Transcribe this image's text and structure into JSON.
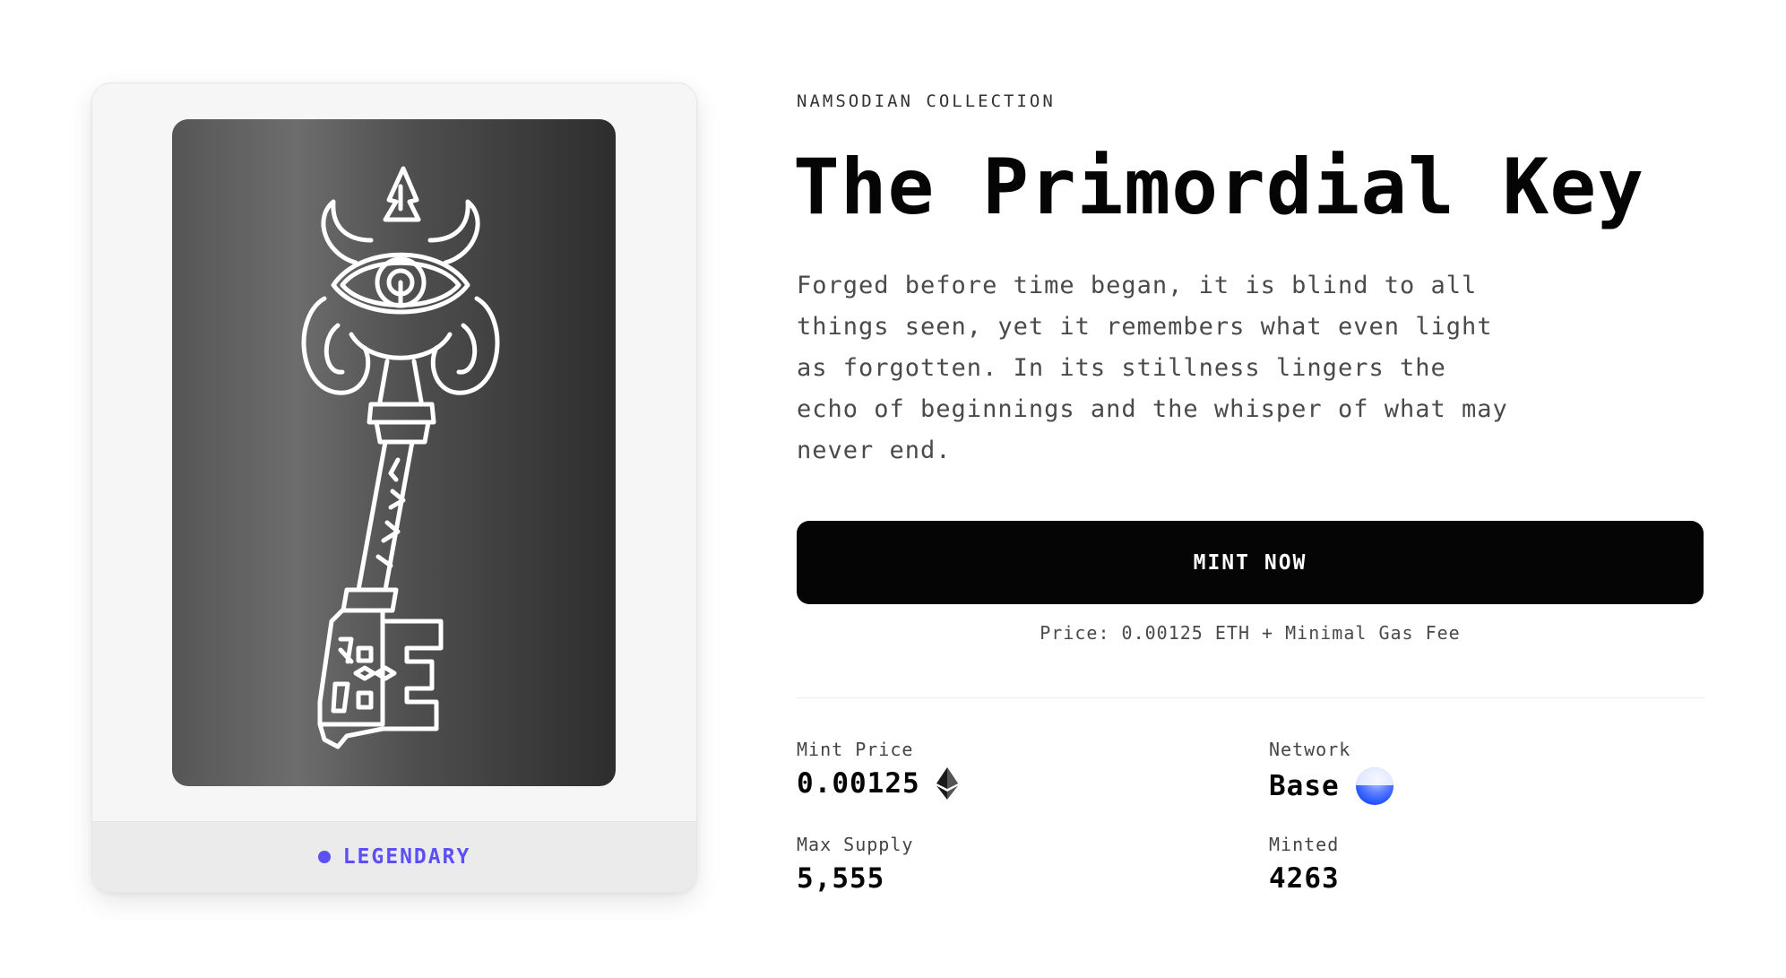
{
  "card": {
    "rarity": "LEGENDARY",
    "rarity_color": "#5b4ff5",
    "image_alt_icon": "primordial-key-artwork"
  },
  "collection": "NAMSODIAN COLLECTION",
  "title": "The Primordial Key",
  "description": "Forged before time began, it is blind to all things seen, yet it remembers what even light as forgotten. In its stillness lingers the echo of beginnings and the whisper of what may never end.",
  "mint_button": "MINT NOW",
  "price_note": "Price: 0.00125 ETH + Minimal Gas Fee",
  "stats": {
    "mint_price": {
      "label": "Mint Price",
      "value": "0.00125",
      "icon": "ethereum-icon"
    },
    "network": {
      "label": "Network",
      "value": "Base",
      "icon": "base-network-icon"
    },
    "max_supply": {
      "label": "Max Supply",
      "value": "5,555"
    },
    "minted": {
      "label": "Minted",
      "value": "4263"
    }
  },
  "colors": {
    "button_bg": "#050505",
    "accent": "#5b4ff5",
    "base_blue": "#1f4fff"
  }
}
